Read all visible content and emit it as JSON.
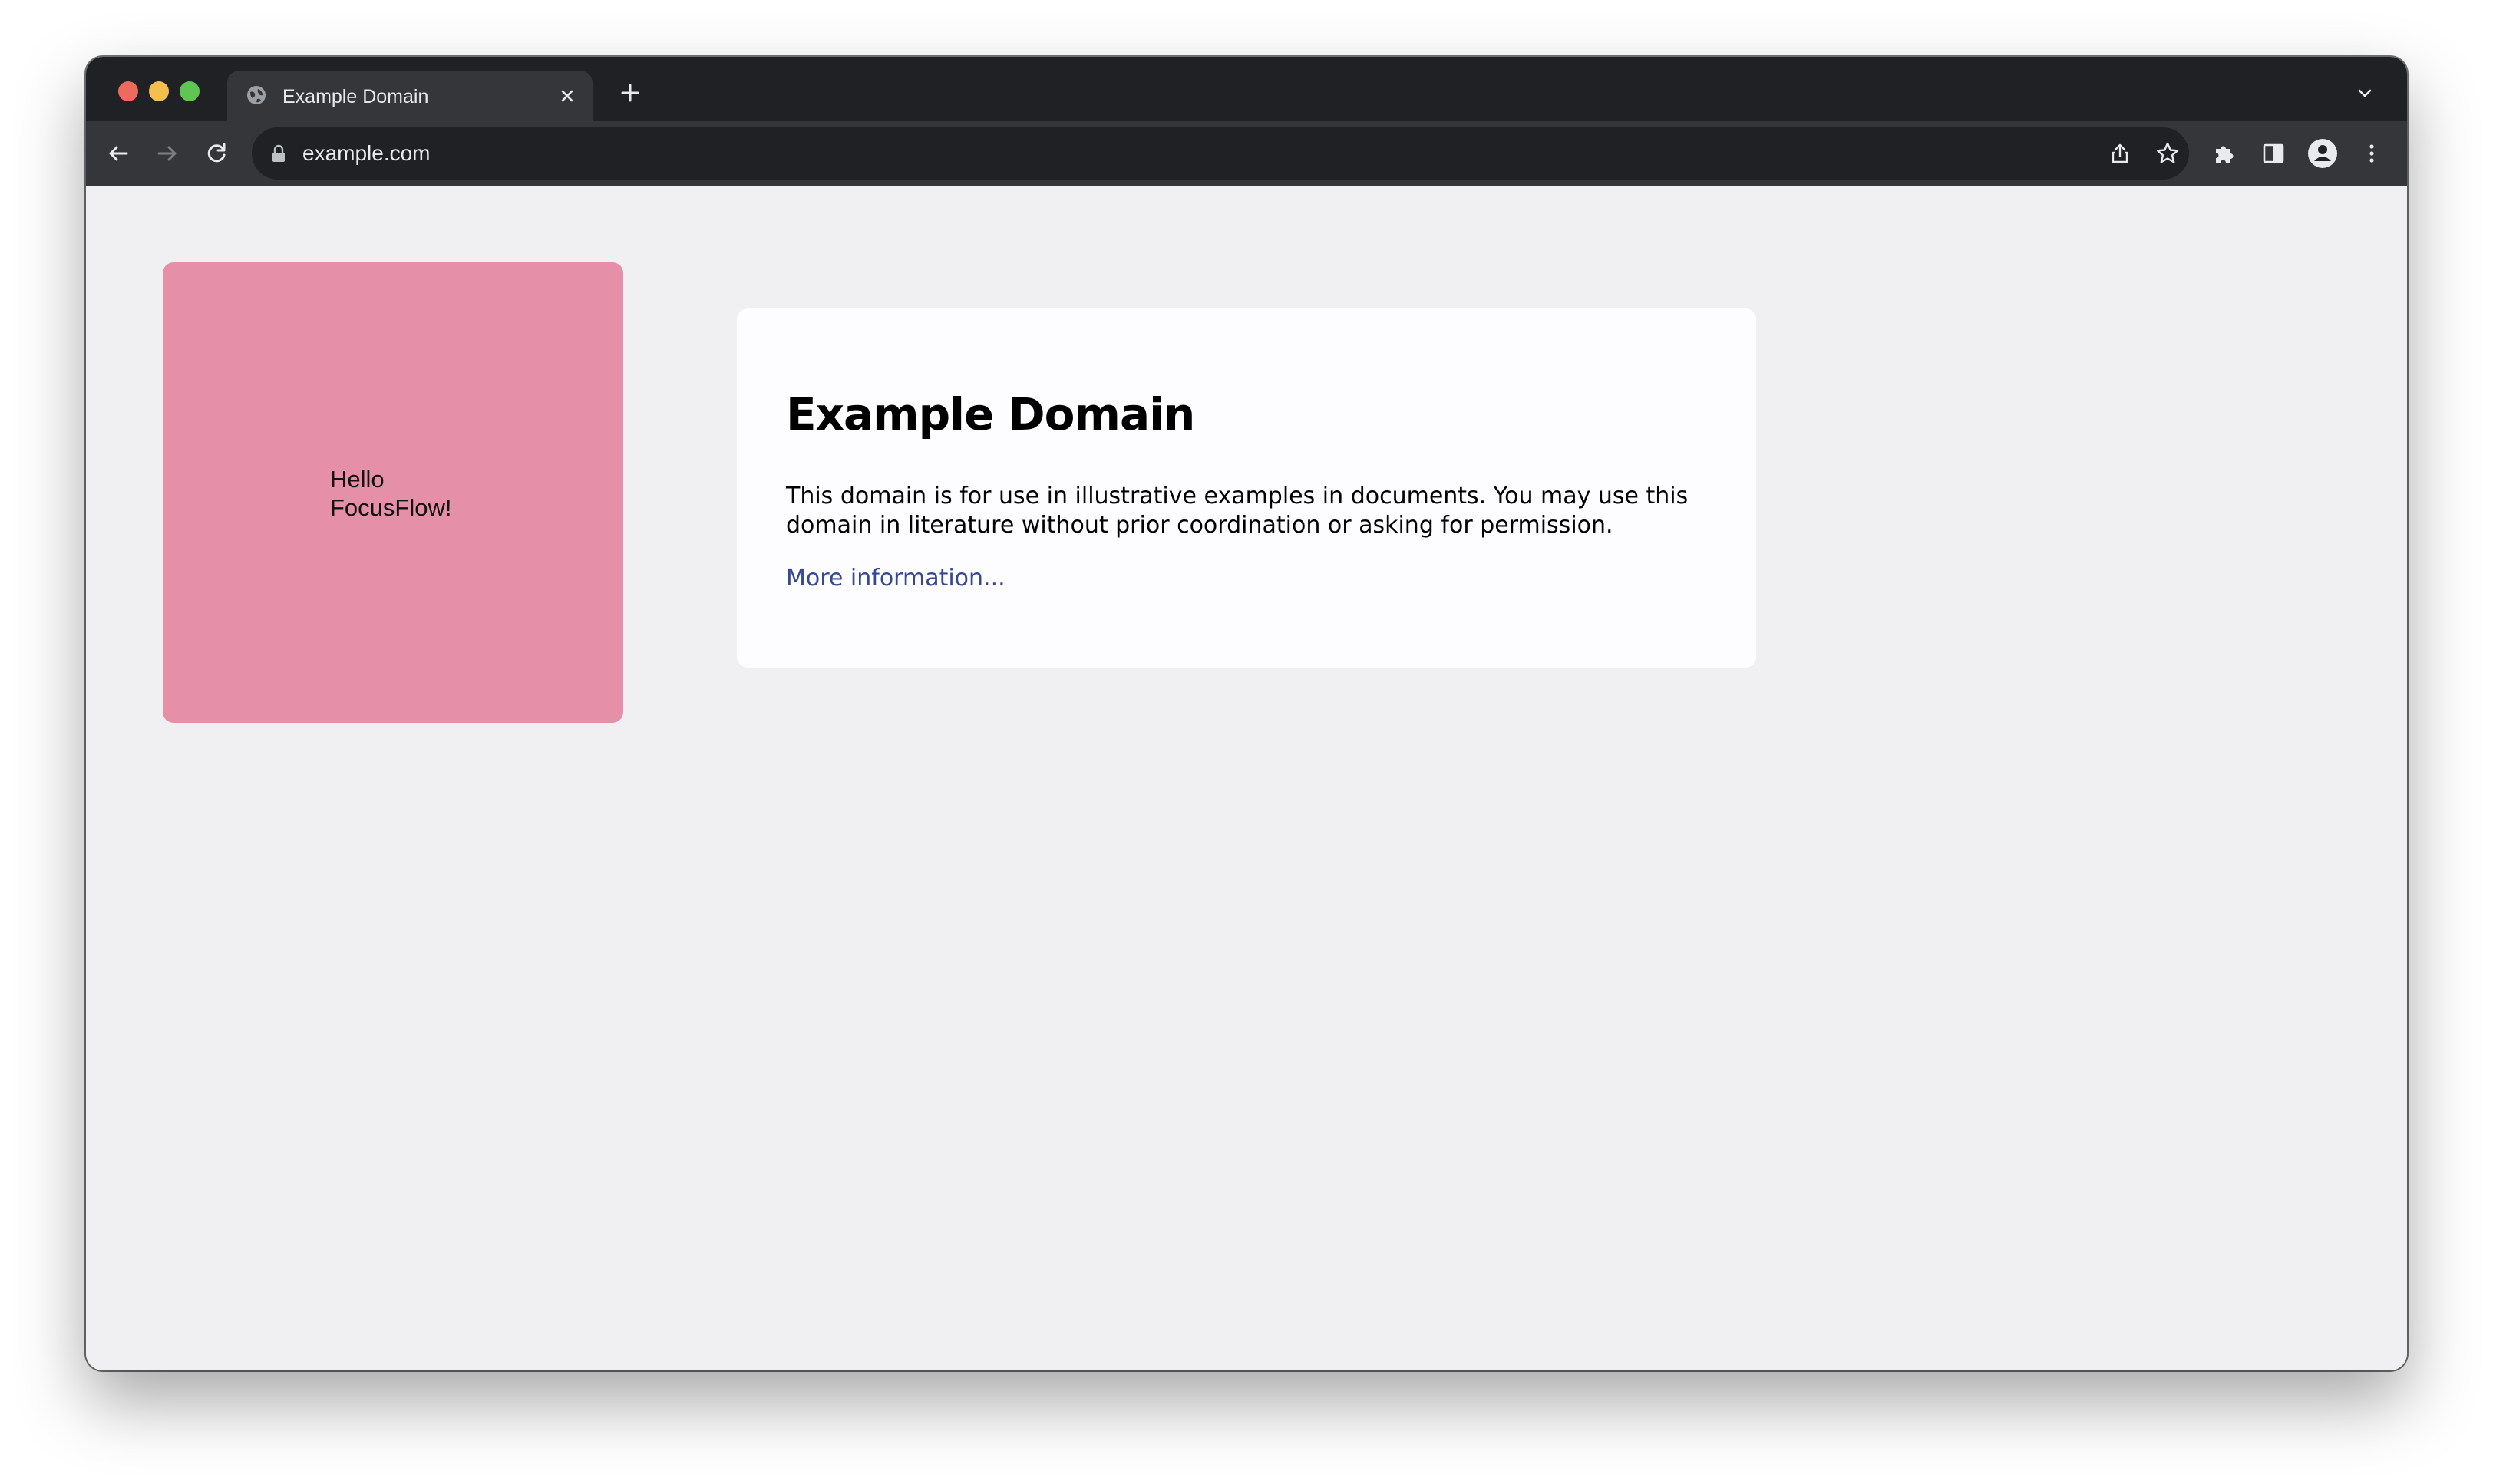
{
  "browser": {
    "tab": {
      "title": "Example Domain",
      "favicon": "globe-icon"
    },
    "address_bar": {
      "url": "example.com"
    },
    "icons": {
      "close_tab": "close-icon",
      "new_tab": "plus-icon",
      "tab_search": "chevron-down-icon",
      "back": "arrow-left-icon",
      "forward": "arrow-right-icon",
      "reload": "reload-icon",
      "share": "share-icon",
      "bookmark": "star-icon",
      "extensions": "puzzle-icon",
      "side_panel": "side-panel-icon",
      "profile": "profile-icon",
      "menu": "kebab-menu-icon"
    },
    "colors": {
      "frame": "#202124",
      "toolbar": "#35363a",
      "close": "#ed6a5e",
      "minimize": "#f5bf4f",
      "zoom": "#61c554"
    }
  },
  "page": {
    "widget": {
      "text_line1": "Hello",
      "text_line2": "FocusFlow!",
      "color": "#e58fa8"
    },
    "card": {
      "title": "Example Domain",
      "description": "This domain is for use in illustrative examples in documents. You may use this domain in literature without prior coordination or asking for permission.",
      "link": "More information..."
    },
    "colors": {
      "background": "#f0f0f2",
      "card": "#fdfdff",
      "link": "#38488f"
    }
  }
}
